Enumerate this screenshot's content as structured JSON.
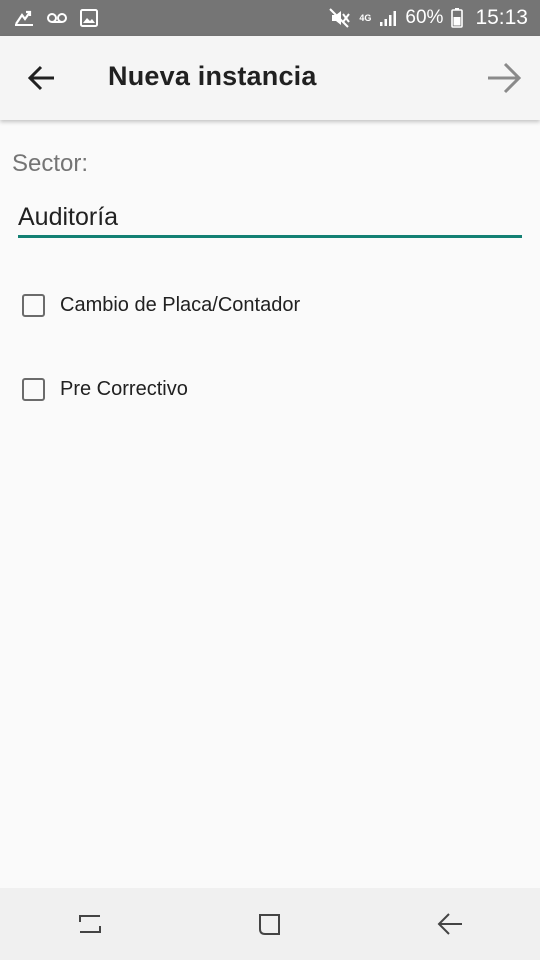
{
  "status_bar": {
    "battery_text": "60%",
    "time": "15:13",
    "network_type": "4G",
    "icons": [
      "missed-call-icon",
      "voicemail-icon",
      "image-icon",
      "mute-icon",
      "signal-icon",
      "battery-icon"
    ]
  },
  "app_bar": {
    "title": "Nueva instancia",
    "back_icon": "arrow-back-icon",
    "next_icon": "arrow-forward-icon"
  },
  "form": {
    "sector_label": "Sector:",
    "sector_value": "Auditoría",
    "accent_color": "#138073",
    "checkboxes": [
      {
        "label": "Cambio de Placa/Contador",
        "checked": false
      },
      {
        "label": "Pre Correctivo",
        "checked": false
      }
    ]
  },
  "nav_bar": {
    "icons": [
      "recent-apps-icon",
      "home-icon",
      "back-nav-icon"
    ]
  }
}
